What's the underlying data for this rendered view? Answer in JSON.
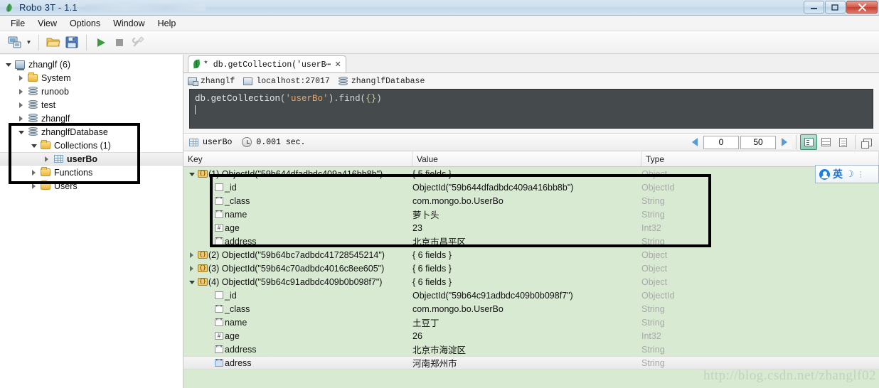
{
  "window": {
    "title": "Robo 3T - 1.1",
    "app_icon": "leaf-icon",
    "minimize_label": "—",
    "restore_label": "❐",
    "close_label": "✕"
  },
  "menubar": {
    "items": [
      {
        "label": "File",
        "name": "menu-file"
      },
      {
        "label": "View",
        "name": "menu-view"
      },
      {
        "label": "Options",
        "name": "menu-options"
      },
      {
        "label": "Window",
        "name": "menu-window"
      },
      {
        "label": "Help",
        "name": "menu-help"
      }
    ]
  },
  "toolbar": {
    "buttons": [
      {
        "name": "connect-button",
        "icon": "computers-icon",
        "title": "Connect"
      },
      {
        "name": "connect-dropdown",
        "icon": "chevron-down-icon",
        "title": "Connect options"
      },
      {
        "name": "open-script-button",
        "icon": "folder-open-icon",
        "title": "Open Script"
      },
      {
        "name": "save-script-button",
        "icon": "save-disk-icon",
        "title": "Save Script"
      },
      {
        "name": "execute-button",
        "icon": "play-icon",
        "title": "Execute"
      },
      {
        "name": "stop-button",
        "icon": "stop-icon",
        "title": "Stop"
      },
      {
        "name": "tools-button",
        "icon": "wrench-icon",
        "title": "Tools"
      }
    ]
  },
  "explorer": {
    "nodes": [
      {
        "label": "zhanglf (6)",
        "icon": "server-icon",
        "indent": 0,
        "state": "expanded",
        "name": "tree-item-connection"
      },
      {
        "label": "System",
        "icon": "folder-icon",
        "indent": 1,
        "state": "collapsed",
        "name": "tree-item-system"
      },
      {
        "label": "runoob",
        "icon": "database-icon",
        "indent": 1,
        "state": "collapsed",
        "name": "tree-item-runoob"
      },
      {
        "label": "test",
        "icon": "database-icon",
        "indent": 1,
        "state": "collapsed",
        "name": "tree-item-test"
      },
      {
        "label": "zhanglf",
        "icon": "database-icon",
        "indent": 1,
        "state": "collapsed",
        "name": "tree-item-zhanglf"
      },
      {
        "label": "zhanglfDatabase",
        "icon": "database-icon",
        "indent": 1,
        "state": "expanded",
        "name": "tree-item-zhanglfdatabase"
      },
      {
        "label": "Collections (1)",
        "icon": "folder-icon",
        "indent": 2,
        "state": "expanded",
        "name": "tree-item-collections"
      },
      {
        "label": "userBo",
        "icon": "collection-icon",
        "indent": 3,
        "state": "collapsed",
        "selected": true,
        "name": "tree-item-userbo"
      },
      {
        "label": "Functions",
        "icon": "folder-icon",
        "indent": 2,
        "state": "collapsed",
        "name": "tree-item-functions"
      },
      {
        "label": "Users",
        "icon": "folder-icon",
        "indent": 2,
        "state": "collapsed",
        "name": "tree-item-users"
      }
    ]
  },
  "tab": {
    "label": "* db.getCollection('userB⋯",
    "icon": "leaf-icon",
    "close_label": "✕"
  },
  "connection_bar": {
    "server": "zhanglf",
    "host": "localhost:27017",
    "database": "zhanglfDatabase",
    "server_icon": "connection-icon",
    "host_icon": "monitor-icon",
    "db_icon": "database-icon"
  },
  "editor": {
    "code_prefix": "db.getCollection",
    "code_open_paren": "(",
    "code_string": "'userBo'",
    "code_mid": ").find(",
    "code_braces": "{}",
    "code_close": ")"
  },
  "results_bar": {
    "collection": "userBo",
    "collection_icon": "collection-icon",
    "time_icon": "clock-icon",
    "time": "0.001 sec.",
    "prev_label": "◀",
    "next_label": "▶",
    "skip": "0",
    "limit": "50",
    "view_modes": [
      {
        "name": "tree-view-button",
        "icon": "tree-view-icon",
        "active": true
      },
      {
        "name": "table-view-button",
        "icon": "table-view-icon",
        "active": false
      },
      {
        "name": "text-view-button",
        "icon": "text-view-icon",
        "active": false
      }
    ],
    "maximize_label": "maximize-panel-icon"
  },
  "grid": {
    "columns": [
      "Key",
      "Value",
      "Type"
    ],
    "rows": [
      {
        "indent": 0,
        "state": "expanded",
        "icon": "object-icon",
        "key": "(1) ObjectId(\"59b644dfadbdc409a416bb8b\")",
        "value": "{ 5 fields }",
        "type": "Object",
        "name": "result-row-1"
      },
      {
        "indent": 1,
        "state": "none",
        "icon": "objectid-icon",
        "key": "_id",
        "value": "ObjectId(\"59b644dfadbdc409a416bb8b\")",
        "type": "ObjectId",
        "name": "result-field-id"
      },
      {
        "indent": 1,
        "state": "none",
        "icon": "string-icon",
        "key": "_class",
        "value": "com.mongo.bo.UserBo",
        "type": "String",
        "name": "result-field-class"
      },
      {
        "indent": 1,
        "state": "none",
        "icon": "string-icon",
        "key": "name",
        "value": "萝卜头",
        "type": "String",
        "name": "result-field-name"
      },
      {
        "indent": 1,
        "state": "none",
        "icon": "int-icon",
        "key": "age",
        "value": "23",
        "type": "Int32",
        "name": "result-field-age"
      },
      {
        "indent": 1,
        "state": "none",
        "icon": "string-icon",
        "key": "address",
        "value": "北京市昌平区",
        "type": "String",
        "name": "result-field-address"
      },
      {
        "indent": 0,
        "state": "collapsed",
        "icon": "object-icon",
        "key": "(2) ObjectId(\"59b64bc7adbdc41728545214\")",
        "value": "{ 6 fields }",
        "type": "Object",
        "name": "result-row-2"
      },
      {
        "indent": 0,
        "state": "collapsed",
        "icon": "object-icon",
        "key": "(3) ObjectId(\"59b64c70adbdc4016c8ee605\")",
        "value": "{ 6 fields }",
        "type": "Object",
        "name": "result-row-3"
      },
      {
        "indent": 0,
        "state": "expanded",
        "icon": "object-icon",
        "key": "(4) ObjectId(\"59b64c91adbdc409b0b098f7\")",
        "value": "{ 6 fields }",
        "type": "Object",
        "name": "result-row-4"
      },
      {
        "indent": 1,
        "state": "none",
        "icon": "objectid-icon",
        "key": "_id",
        "value": "ObjectId(\"59b64c91adbdc409b0b098f7\")",
        "type": "ObjectId",
        "name": "result-field-id-4"
      },
      {
        "indent": 1,
        "state": "none",
        "icon": "string-icon",
        "key": "_class",
        "value": "com.mongo.bo.UserBo",
        "type": "String",
        "name": "result-field-class-4"
      },
      {
        "indent": 1,
        "state": "none",
        "icon": "string-icon",
        "key": "name",
        "value": "土豆丁",
        "type": "String",
        "name": "result-field-name-4"
      },
      {
        "indent": 1,
        "state": "none",
        "icon": "int-icon",
        "key": "age",
        "value": "26",
        "type": "Int32",
        "name": "result-field-age-4"
      },
      {
        "indent": 1,
        "state": "none",
        "icon": "string-icon",
        "key": "address",
        "value": "北京市海淀区",
        "type": "String",
        "name": "result-field-address-4"
      },
      {
        "indent": 1,
        "state": "none",
        "icon": "string-icon-blue",
        "key": "adress",
        "value": "河南郑州市",
        "type": "String",
        "selected": true,
        "name": "result-field-adress-4"
      }
    ]
  },
  "ime": {
    "mode": "英",
    "moon": "☽",
    "grip": "⋮"
  },
  "watermark": "http://blog.csdn.net/zhanglf02",
  "colors": {
    "result_background": "#d9ead3",
    "editor_background": "#454a4d",
    "accent_green": "#2e9a43",
    "annotation": "#000000"
  }
}
